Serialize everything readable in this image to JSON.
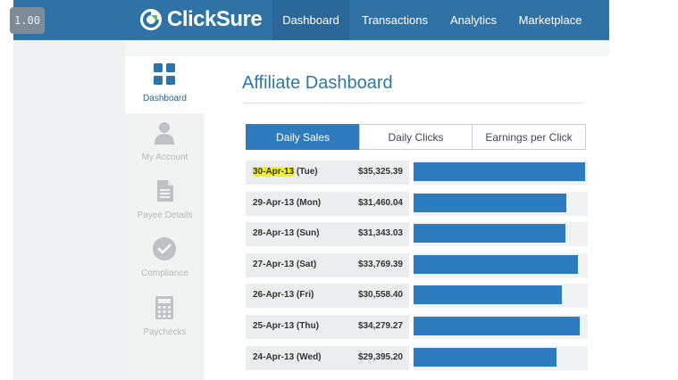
{
  "zoom": "1.00",
  "brand": {
    "name": "ClickSure"
  },
  "nav": {
    "items": [
      {
        "label": "Dashboard",
        "active": true
      },
      {
        "label": "Transactions",
        "active": false
      },
      {
        "label": "Analytics",
        "active": false
      },
      {
        "label": "Marketplace",
        "active": false
      }
    ]
  },
  "sidebar": {
    "items": [
      {
        "label": "Dashboard",
        "icon": "grid-icon",
        "active": true
      },
      {
        "label": "My Account",
        "icon": "user-icon",
        "active": false
      },
      {
        "label": "Payee Details",
        "icon": "document-icon",
        "active": false
      },
      {
        "label": "Compliance",
        "icon": "checkmark-icon",
        "active": false
      },
      {
        "label": "Paychecks",
        "icon": "calculator-icon",
        "active": false
      }
    ]
  },
  "main": {
    "title": "Affiliate Dashboard",
    "tabs": [
      {
        "label": "Daily Sales",
        "active": true
      },
      {
        "label": "Daily Clicks",
        "active": false
      },
      {
        "label": "Earnings per Click",
        "active": false
      }
    ]
  },
  "chart_data": {
    "type": "bar",
    "title": "",
    "categories": [
      "30-Apr-13 (Tue)",
      "29-Apr-13 (Mon)",
      "28-Apr-13 (Sun)",
      "27-Apr-13 (Sat)",
      "26-Apr-13 (Fri)",
      "25-Apr-13 (Thu)",
      "24-Apr-13 (Wed)"
    ],
    "date_parts": [
      {
        "date": "30-Apr-13",
        "day": "(Tue)",
        "highlight": true
      },
      {
        "date": "29-Apr-13",
        "day": "(Mon)",
        "highlight": false
      },
      {
        "date": "28-Apr-13",
        "day": "(Sun)",
        "highlight": false
      },
      {
        "date": "27-Apr-13",
        "day": "(Sat)",
        "highlight": false
      },
      {
        "date": "26-Apr-13",
        "day": "(Fri)",
        "highlight": false
      },
      {
        "date": "25-Apr-13",
        "day": "(Thu)",
        "highlight": false
      },
      {
        "date": "24-Apr-13",
        "day": "(Wed)",
        "highlight": false
      }
    ],
    "labels": [
      "$35,325.39",
      "$31,460.04",
      "$31,343.03",
      "$33,769.39",
      "$30,558.40",
      "$34,279.27",
      "$29,395.20"
    ],
    "values": [
      35325.39,
      31460.04,
      31343.03,
      33769.39,
      30558.4,
      34279.27,
      29395.2
    ],
    "bar_color": "#2e7cc0",
    "highlight_color": "#f3f21a"
  }
}
